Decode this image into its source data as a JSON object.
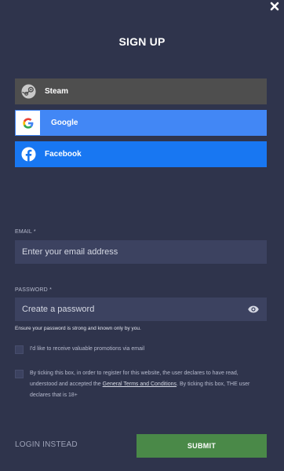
{
  "modal": {
    "title": "SIGN UP",
    "close_icon": "close-icon"
  },
  "social": {
    "steam": {
      "label": "Steam",
      "icon": "steam-icon",
      "color": "#4e4e4e"
    },
    "google": {
      "label": "Google",
      "icon": "google-icon",
      "color": "#4287f5"
    },
    "facebook": {
      "label": "Facebook",
      "icon": "facebook-icon",
      "color": "#1877f2"
    }
  },
  "email": {
    "label": "EMAIL",
    "required_mark": "*",
    "placeholder": "Enter your email address",
    "value": ""
  },
  "password": {
    "label": "PASSWORD",
    "required_mark": "*",
    "placeholder": "Create a password",
    "value": "",
    "hint": "Ensure your password is strong and known only by you.",
    "toggle_icon": "eye-icon"
  },
  "promotions_checkbox": {
    "label": "I'd like to receive valuable promotions via email",
    "checked": false
  },
  "terms_checkbox": {
    "text_before": "By ticking this box, in order to register for this website, the user declares to have read, understood and accepted the ",
    "link_text": "General Terms and Conditions",
    "text_after": ". By ticking this box, THE user declares that is 18+",
    "checked": false
  },
  "actions": {
    "login_label": "LOGIN INSTEAD",
    "submit_label": "SUBMIT",
    "submit_color": "#4a8948"
  }
}
